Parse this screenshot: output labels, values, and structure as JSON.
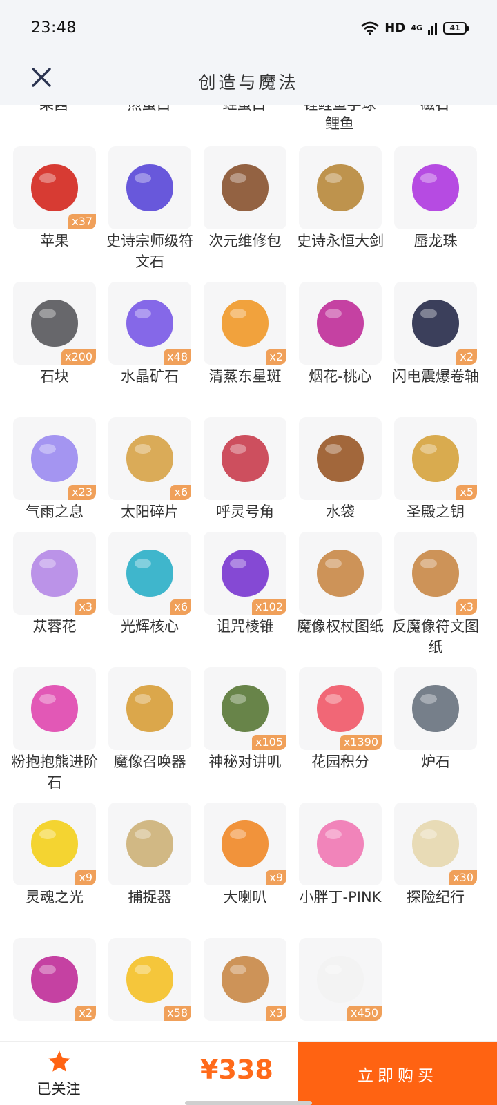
{
  "status_bar": {
    "time": "23:48",
    "hd": "HD",
    "network": "4G",
    "battery": "41"
  },
  "nav": {
    "title": "创造与魔法"
  },
  "partial_row_labels": [
    "果酱",
    "煎蛋白",
    "蛙蛋白",
    "锂鲤鱼手球",
    "鲤鱼",
    "磁石"
  ],
  "items": [
    {
      "name": "苹果",
      "count": "x37",
      "icon": "apple-icon",
      "color": "#d42a22"
    },
    {
      "name": "史诗宗师级符文石",
      "count": "",
      "icon": "rune-stone-icon",
      "color": "#5b4ad8"
    },
    {
      "name": "次元维修包",
      "count": "",
      "icon": "repair-bag-icon",
      "color": "#8a5532"
    },
    {
      "name": "史诗永恒大剑",
      "count": "",
      "icon": "sword-icon",
      "color": "#b98a3e"
    },
    {
      "name": "蜃龙珠",
      "count": "",
      "icon": "pearl-icon",
      "color": "#b03ce0"
    },
    {
      "name": "石块",
      "count": "x200",
      "icon": "stone-icon",
      "color": "#5a5a5e"
    },
    {
      "name": "水晶矿石",
      "count": "x48",
      "icon": "crystal-icon",
      "color": "#7b5be6"
    },
    {
      "name": "清蒸东星斑",
      "count": "x2",
      "icon": "fish-dish-icon",
      "color": "#f09a2c"
    },
    {
      "name": "烟花-桃心",
      "count": "",
      "icon": "firework-icon",
      "color": "#c0319a"
    },
    {
      "name": "闪电震爆卷轴",
      "count": "x2",
      "icon": "scroll-icon",
      "color": "#2a2f4d"
    },
    {
      "name": "气雨之息",
      "count": "x23",
      "icon": "orb-icon",
      "color": "#9c8cf0"
    },
    {
      "name": "太阳碎片",
      "count": "x6",
      "icon": "sun-shard-icon",
      "color": "#d7a44a"
    },
    {
      "name": "呼灵号角",
      "count": "",
      "icon": "horn-icon",
      "color": "#c94050"
    },
    {
      "name": "水袋",
      "count": "",
      "icon": "water-bag-icon",
      "color": "#9a5a2a"
    },
    {
      "name": "圣殿之钥",
      "count": "x5",
      "icon": "key-icon",
      "color": "#d6a440"
    },
    {
      "name": "苁蓉花",
      "count": "x3",
      "icon": "flower-icon",
      "color": "#b58ae6"
    },
    {
      "name": "光辉核心",
      "count": "x6",
      "icon": "core-icon",
      "color": "#2fb0c8"
    },
    {
      "name": "诅咒棱锥",
      "count": "x102",
      "icon": "pyramid-icon",
      "color": "#7b3ad0"
    },
    {
      "name": "魔像权杖图纸",
      "count": "",
      "icon": "blueprint-icon",
      "color": "#c98a4a"
    },
    {
      "name": "反魔像符文图纸",
      "count": "x3",
      "icon": "blueprint-icon",
      "color": "#c98a4a"
    },
    {
      "name": "粉抱抱熊进阶石",
      "count": "",
      "icon": "gem-icon",
      "color": "#e04ab0"
    },
    {
      "name": "魔像召唤器",
      "count": "",
      "icon": "summoner-icon",
      "color": "#d8a03c"
    },
    {
      "name": "神秘对讲叽",
      "count": "x105",
      "icon": "walkie-talkie-icon",
      "color": "#5b7a3a"
    },
    {
      "name": "花园积分",
      "count": "x1390",
      "icon": "garden-badge-icon",
      "color": "#f05a6a"
    },
    {
      "name": "炉石",
      "count": "",
      "icon": "hearthstone-icon",
      "color": "#6a7480"
    },
    {
      "name": "灵魂之光",
      "count": "x9",
      "icon": "soul-light-icon",
      "color": "#f3d020"
    },
    {
      "name": "捕捉器",
      "count": "",
      "icon": "catcher-icon",
      "color": "#cdb27a"
    },
    {
      "name": "大喇叭",
      "count": "x9",
      "icon": "megaphone-icon",
      "color": "#f08a2a"
    },
    {
      "name": "小胖丁-PINK",
      "count": "",
      "icon": "car-icon",
      "color": "#f07ab4"
    },
    {
      "name": "探险纪行",
      "count": "x30",
      "icon": "paper-scroll-icon",
      "color": "#e6d8b0"
    },
    {
      "name": "",
      "count": "x2",
      "icon": "firework-icon",
      "color": "#c0319a"
    },
    {
      "name": "",
      "count": "x58",
      "icon": "shirt-icon",
      "color": "#f4c12a"
    },
    {
      "name": "",
      "count": "x3",
      "icon": "blueprint-icon",
      "color": "#c98a4a"
    },
    {
      "name": "",
      "count": "x450",
      "icon": "white-cube-icon",
      "color": "#f2f2f2"
    }
  ],
  "bottom": {
    "follow_label": "已关注",
    "price": "¥338",
    "buy_label": "立即购买"
  },
  "colors": {
    "accent": "#ff6312",
    "badge": "#f0a05a",
    "price": "#ff6a1a"
  }
}
